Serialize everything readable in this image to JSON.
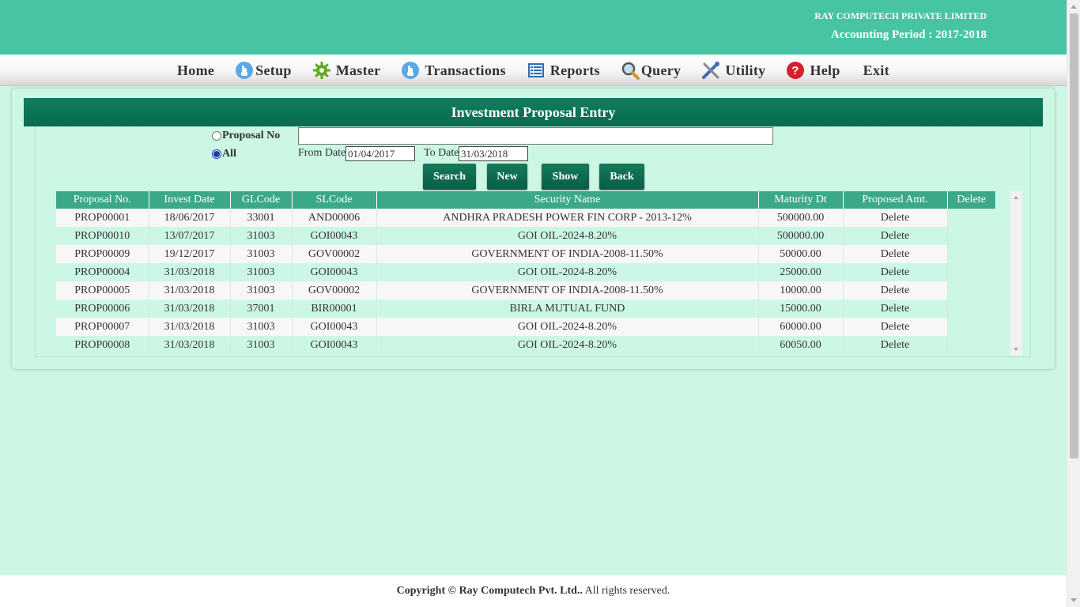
{
  "header": {
    "company": "RAY COMPUTECH PRIVATE LIMITED",
    "period": "Accounting Period : 2017-2018"
  },
  "menu": {
    "home": "Home",
    "setup": "Setup",
    "master": "Master",
    "transactions": "Transactions",
    "reports": "Reports",
    "query": "Query",
    "utility": "Utility",
    "help": "Help",
    "exit": "Exit"
  },
  "form": {
    "title": "Investment Proposal Entry",
    "radio_proposal_no": "Proposal No",
    "radio_all": "All",
    "selected_radio": "All",
    "proposal_no_value": "",
    "from_date_label": "From Date",
    "from_date_value": "01/04/2017",
    "to_date_label": "To Date",
    "to_date_value": "31/03/2018",
    "buttons": {
      "search": "Search",
      "new": "New",
      "show": "Show",
      "back": "Back"
    }
  },
  "table": {
    "columns": [
      "Proposal No.",
      "Invest Date",
      "GLCode",
      "SLCode",
      "Security Name",
      "Maturity Dt",
      "Proposed Amt.",
      "Delete"
    ],
    "rows": [
      {
        "proposal_no": "PROP00001",
        "invest_date": "18/06/2017",
        "glcode": "33001",
        "slcode": "AND00006",
        "security_name": "ANDHRA PRADESH POWER FIN CORP - 2013-12%",
        "maturity_dt": "500000.00",
        "proposed_amt": "Delete",
        "delete": ""
      },
      {
        "proposal_no": "PROP00010",
        "invest_date": "13/07/2017",
        "glcode": "31003",
        "slcode": "GOI00043",
        "security_name": "GOI OIL-2024-8.20%",
        "maturity_dt": "500000.00",
        "proposed_amt": "Delete",
        "delete": ""
      },
      {
        "proposal_no": "PROP00009",
        "invest_date": "19/12/2017",
        "glcode": "31003",
        "slcode": "GOV00002",
        "security_name": "GOVERNMENT OF INDIA-2008-11.50%",
        "maturity_dt": "50000.00",
        "proposed_amt": "Delete",
        "delete": ""
      },
      {
        "proposal_no": "PROP00004",
        "invest_date": "31/03/2018",
        "glcode": "31003",
        "slcode": "GOI00043",
        "security_name": "GOI OIL-2024-8.20%",
        "maturity_dt": "25000.00",
        "proposed_amt": "Delete",
        "delete": ""
      },
      {
        "proposal_no": "PROP00005",
        "invest_date": "31/03/2018",
        "glcode": "31003",
        "slcode": "GOV00002",
        "security_name": "GOVERNMENT OF INDIA-2008-11.50%",
        "maturity_dt": "10000.00",
        "proposed_amt": "Delete",
        "delete": ""
      },
      {
        "proposal_no": "PROP00006",
        "invest_date": "31/03/2018",
        "glcode": "37001",
        "slcode": "BIR00001",
        "security_name": "BIRLA MUTUAL FUND",
        "maturity_dt": "15000.00",
        "proposed_amt": "Delete",
        "delete": ""
      },
      {
        "proposal_no": "PROP00007",
        "invest_date": "31/03/2018",
        "glcode": "31003",
        "slcode": "GOI00043",
        "security_name": "GOI OIL-2024-8.20%",
        "maturity_dt": "60000.00",
        "proposed_amt": "Delete",
        "delete": ""
      },
      {
        "proposal_no": "PROP00008",
        "invest_date": "31/03/2018",
        "glcode": "31003",
        "slcode": "GOI00043",
        "security_name": "GOI OIL-2024-8.20%",
        "maturity_dt": "60050.00",
        "proposed_amt": "Delete",
        "delete": ""
      }
    ]
  },
  "footer": {
    "copyright": "Copyright © Ray Computech Pvt. Ltd..",
    "rights": " All rights reserved."
  },
  "icons": {
    "setup": "hand-pointer-icon",
    "master": "gear-icon",
    "transactions": "hand-pointer-icon",
    "reports": "report-icon",
    "query": "magnifier-icon",
    "utility": "tools-icon",
    "help": "question-icon"
  },
  "colors": {
    "header_bg": "#47c4a3",
    "page_bg": "#ccf7e4",
    "title_bar": "#0a6a4f",
    "table_header": "#3ca88a",
    "button": "#0a5c44"
  }
}
